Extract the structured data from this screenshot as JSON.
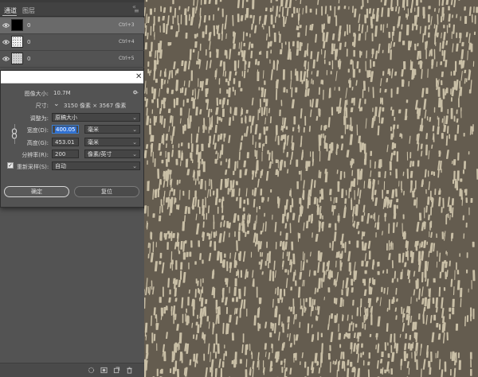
{
  "panel": {
    "tabs": [
      {
        "label": "通道"
      },
      {
        "label": "图层"
      }
    ],
    "close_glyph": "«",
    "menu_glyph": "≡",
    "channels": [
      {
        "name": "0",
        "shortcut": "Ctrl+3",
        "selected": true
      },
      {
        "name": "0",
        "shortcut": "Ctrl+4",
        "selected": false
      },
      {
        "name": "0",
        "shortcut": "Ctrl+5",
        "selected": false
      }
    ]
  },
  "dialog": {
    "close_glyph": "✕",
    "image_size_label": "图像大小:",
    "image_size_value": "10.7M",
    "dimensions_label": "尺寸:",
    "dimensions_value": "3150 像素 × 3567 像素",
    "fit_label": "调整为:",
    "fit_value": "原稿大小",
    "width_label": "宽度(D):",
    "width_value": "400.05",
    "width_unit": "毫米",
    "height_label": "高度(G):",
    "height_value": "453.01",
    "height_unit": "毫米",
    "resolution_label": "分辨率(R):",
    "resolution_value": "200",
    "resolution_unit": "像素/英寸",
    "resample_label": "重新采样(S):",
    "resample_checked": true,
    "resample_check_glyph": "✓",
    "resample_value": "自动",
    "ok_label": "确定",
    "reset_label": "复位"
  },
  "colors": {
    "canvas_bg": "#645c4f",
    "canvas_marks": "#c9bfa6",
    "panel_bg": "#535353",
    "focus": "#3a7fd6"
  }
}
